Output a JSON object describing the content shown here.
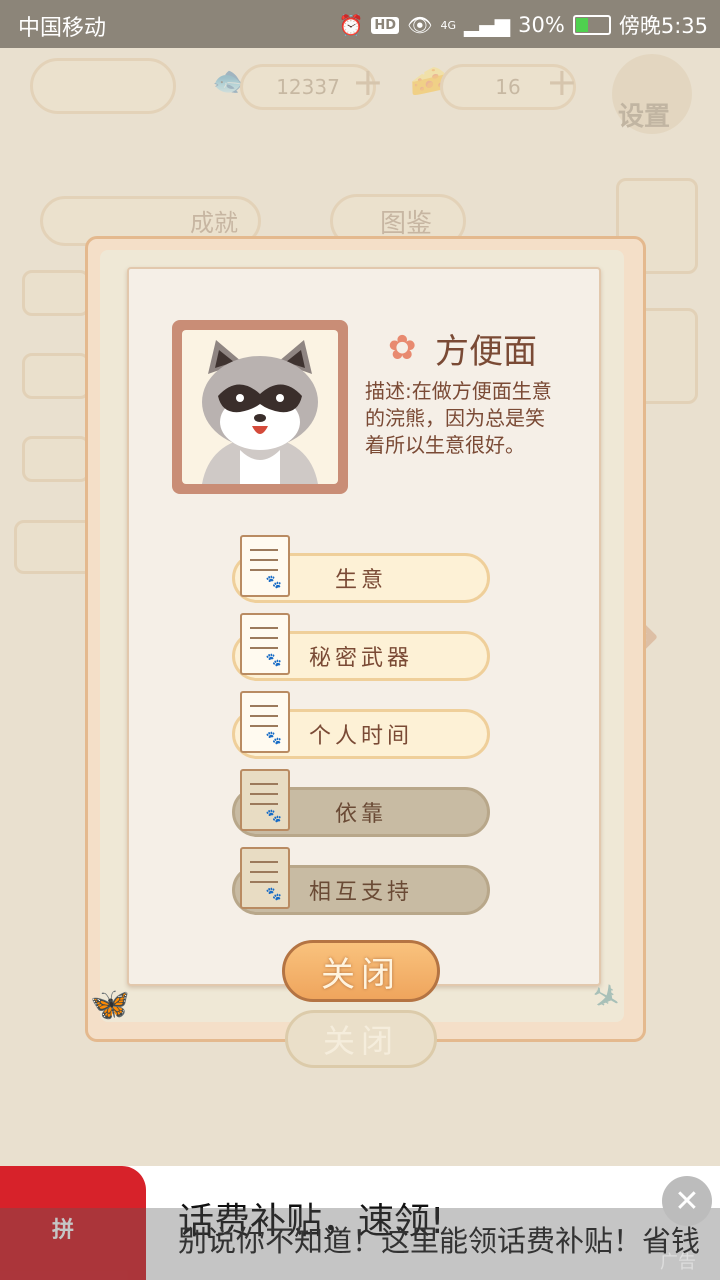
{
  "status_bar": {
    "carrier": "中国移动",
    "hd": "HD",
    "network": "4G",
    "battery": "30%",
    "time": "傍晚5:35",
    "battery_level": 0.3
  },
  "hud": {
    "fish_count": "12337",
    "cheese_count": "16",
    "settings_label": "设置"
  },
  "tabs": {
    "achievements": "成就",
    "catalog": "图鉴"
  },
  "character": {
    "name": "方便面",
    "description": "描述:在做方便面生意的浣熊，因为总是笑着所以生意很好。"
  },
  "story_items": [
    {
      "label": "生意",
      "unlocked": true
    },
    {
      "label": "秘密武器",
      "unlocked": true
    },
    {
      "label": "个人时间",
      "unlocked": true
    },
    {
      "label": "依靠",
      "unlocked": false
    },
    {
      "label": "相互支持",
      "unlocked": false
    }
  ],
  "close_label": "关闭",
  "ad": {
    "logo_text": "拼",
    "title": "话费补贴，速领!",
    "subtitle": "别说你不知道！这里能领话费补贴！省钱",
    "close_icon": "close-icon",
    "label": "广告"
  }
}
